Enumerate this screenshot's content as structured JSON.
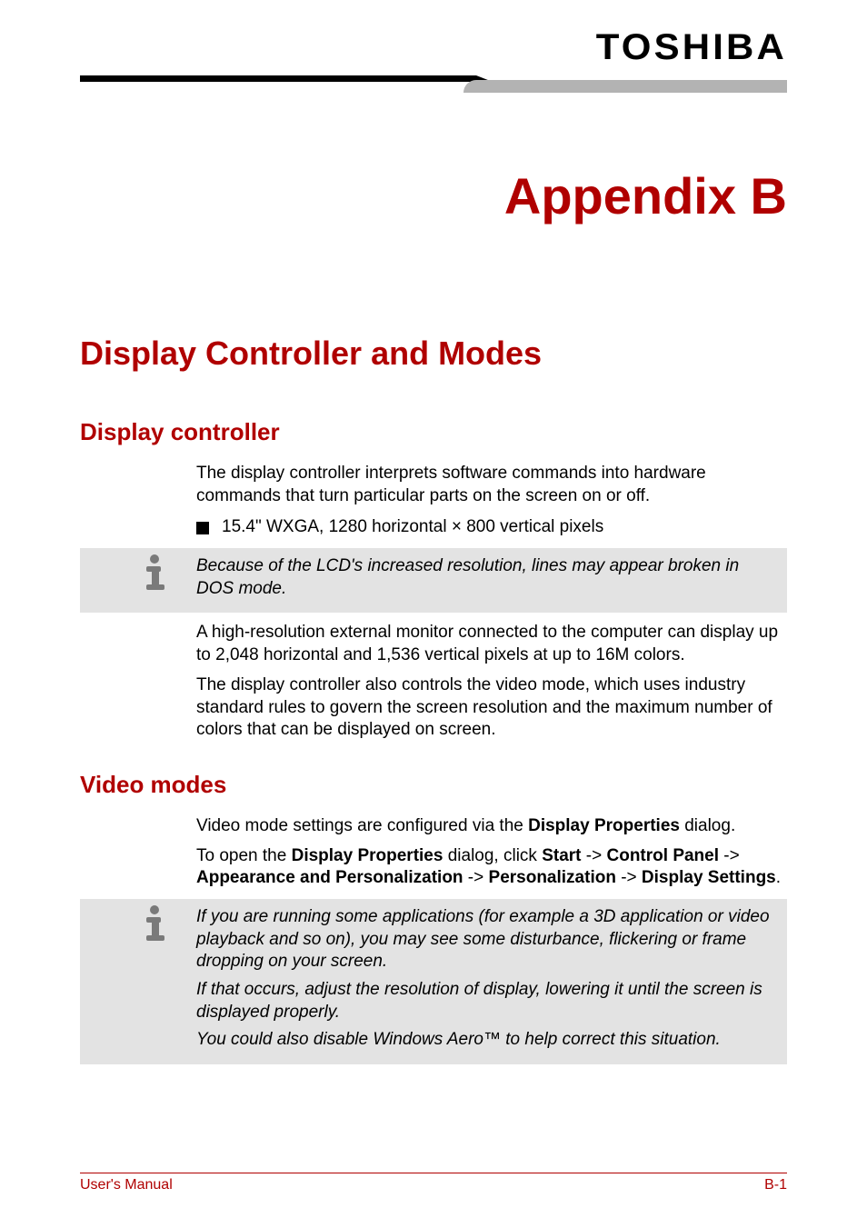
{
  "brand": "TOSHIBA",
  "appendix_title": "Appendix B",
  "section_title": "Display Controller and Modes",
  "sub1": {
    "title": "Display controller",
    "para1": "The display controller interprets software commands into hardware commands that turn particular parts on the screen on or off.",
    "bullet1": "15.4\" WXGA, 1280 horizontal × 800 vertical pixels",
    "note1": "Because of the LCD's increased resolution, lines may appear broken in DOS mode.",
    "para2": "A high-resolution external monitor connected to the computer can display up to 2,048 horizontal and 1,536 vertical pixels at up to 16M colors.",
    "para3": "The display controller also controls the video mode, which uses industry standard rules to govern the screen resolution and the maximum number of colors that can be displayed on screen."
  },
  "sub2": {
    "title": "Video modes",
    "para1_pre": "Video mode settings are configured via the ",
    "para1_bold": "Display Properties",
    "para1_post": " dialog.",
    "instr_open": "To open the ",
    "instr_b1": "Display Properties",
    "instr_m1": " dialog, click ",
    "instr_b2": "Start",
    "instr_arrow": " -> ",
    "instr_b3": "Control Panel",
    "instr_b4": "Appearance and Personalization",
    "instr_b5": "Personalization",
    "instr_b6": "Display Settings",
    "instr_period": ".",
    "note_p1": "If you are running some applications (for example a 3D application or video playback and so on), you may see some disturbance, flickering or frame dropping on your screen.",
    "note_p2": "If that occurs, adjust the resolution of display, lowering it until the screen is displayed properly.",
    "note_p3": "You could also disable Windows Aero™ to help correct this situation."
  },
  "footer": {
    "left": "User's Manual",
    "right": "B-1"
  }
}
